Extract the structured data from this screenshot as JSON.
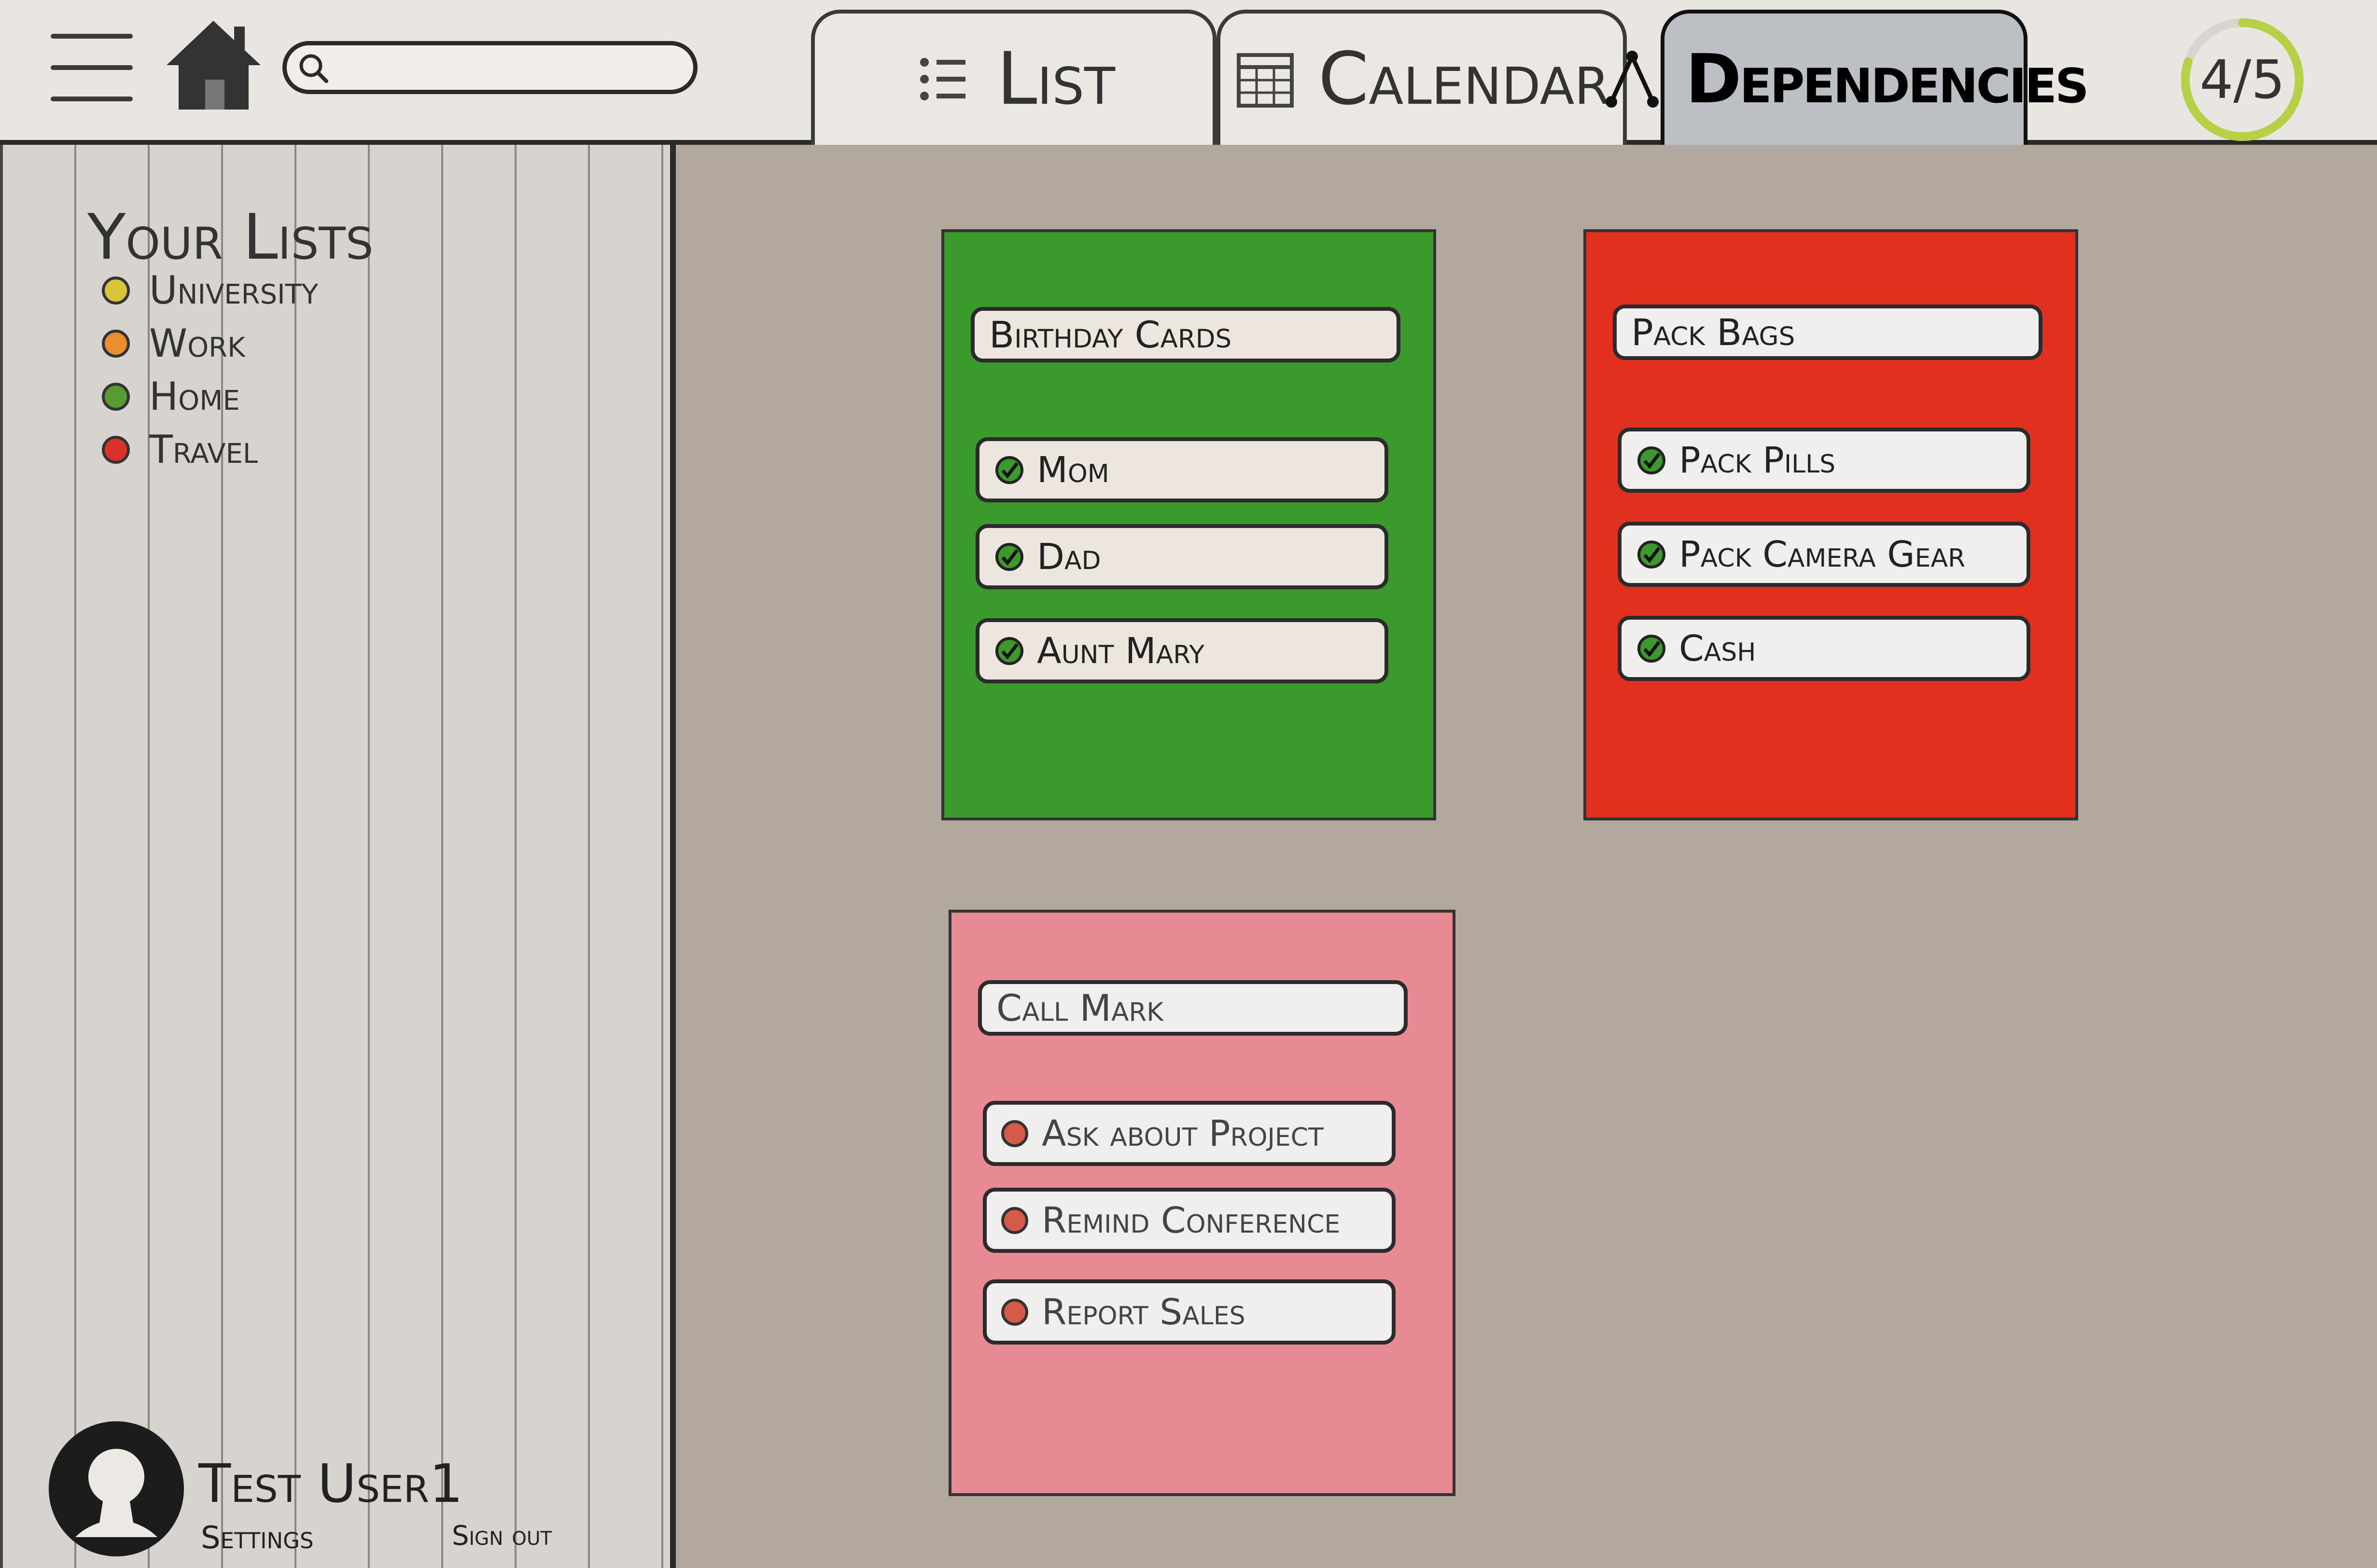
{
  "header": {
    "search": {
      "value": "",
      "placeholder": ""
    },
    "tabs": [
      {
        "label": "List",
        "icon": "list-icon",
        "active": false
      },
      {
        "label": "Calendar",
        "icon": "calendar-icon",
        "active": false
      },
      {
        "label": "Dependencies",
        "icon": "dependency-icon",
        "active": true
      }
    ],
    "progress": {
      "text": "4/5",
      "fraction": 0.8
    }
  },
  "sidebar": {
    "title": "Your Lists",
    "lists": [
      {
        "label": "University",
        "color": "#d8c53a"
      },
      {
        "label": "Work",
        "color": "#e8902f"
      },
      {
        "label": "Home",
        "color": "#5a9a35"
      },
      {
        "label": "Travel",
        "color": "#d8322a"
      }
    ],
    "user": {
      "name": "Test User1",
      "settings": "Settings",
      "signout": "Sign out"
    }
  },
  "cards": [
    {
      "title": "Birthday Cards",
      "color": "#3a9a2c",
      "items": [
        {
          "label": "Mom",
          "done": true
        },
        {
          "label": "Dad",
          "done": true
        },
        {
          "label": "Aunt Mary",
          "done": true
        }
      ]
    },
    {
      "title": "Pack Bags",
      "color": "#e1301e",
      "items": [
        {
          "label": "Pack Pills",
          "done": true
        },
        {
          "label": "Pack Camera Gear",
          "done": true
        },
        {
          "label": "Cash",
          "done": true
        }
      ]
    },
    {
      "title": "Call Mark",
      "color": "#e88a93",
      "items": [
        {
          "label": "Ask about Project",
          "done": false
        },
        {
          "label": "Remind Conference",
          "done": false
        },
        {
          "label": "Report Sales",
          "done": false
        }
      ]
    }
  ]
}
